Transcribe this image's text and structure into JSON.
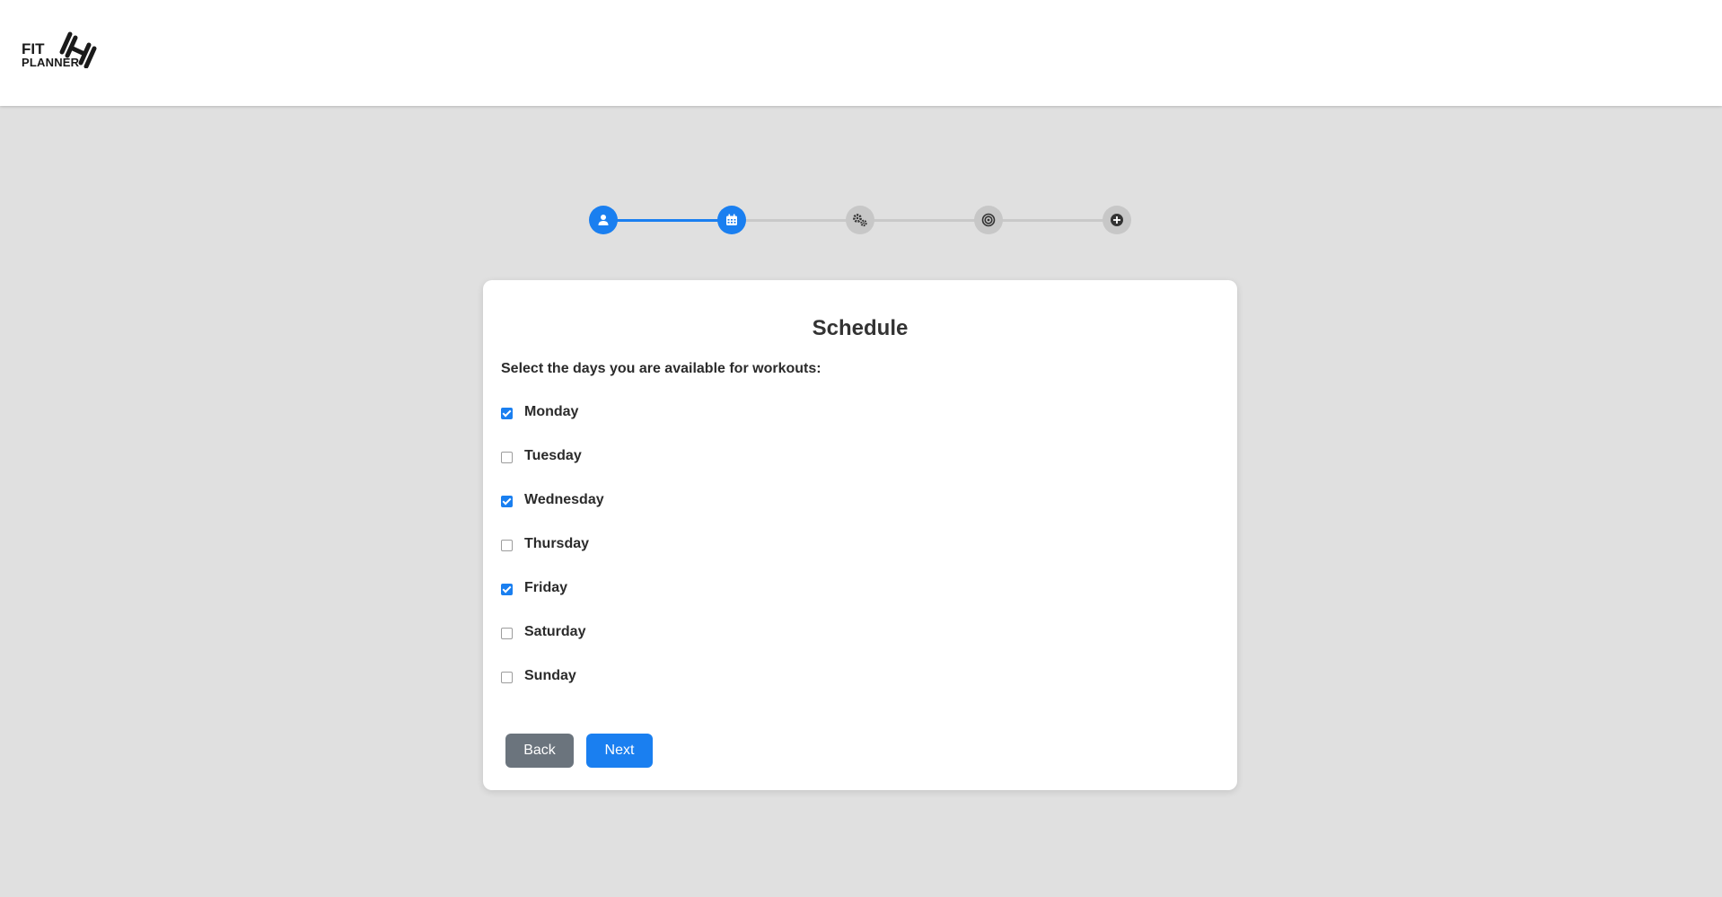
{
  "brand": {
    "line1": "FIT",
    "line2": "PLANNER",
    "icon": "dumbbell-icon"
  },
  "stepper": {
    "steps": [
      {
        "icon": "user-icon",
        "active": true
      },
      {
        "icon": "calendar-icon",
        "active": true
      },
      {
        "icon": "gears-icon",
        "active": false
      },
      {
        "icon": "target-icon",
        "active": false
      },
      {
        "icon": "plus-circle-icon",
        "active": false
      }
    ],
    "active_color": "#1a7ff0",
    "inactive_color": "#c7c7c7"
  },
  "card": {
    "title": "Schedule",
    "prompt": "Select the days you are available for workouts:",
    "days": [
      {
        "label": "Monday",
        "checked": true
      },
      {
        "label": "Tuesday",
        "checked": false
      },
      {
        "label": "Wednesday",
        "checked": true
      },
      {
        "label": "Thursday",
        "checked": false
      },
      {
        "label": "Friday",
        "checked": true
      },
      {
        "label": "Saturday",
        "checked": false
      },
      {
        "label": "Sunday",
        "checked": false
      }
    ],
    "back_label": "Back",
    "next_label": "Next"
  }
}
